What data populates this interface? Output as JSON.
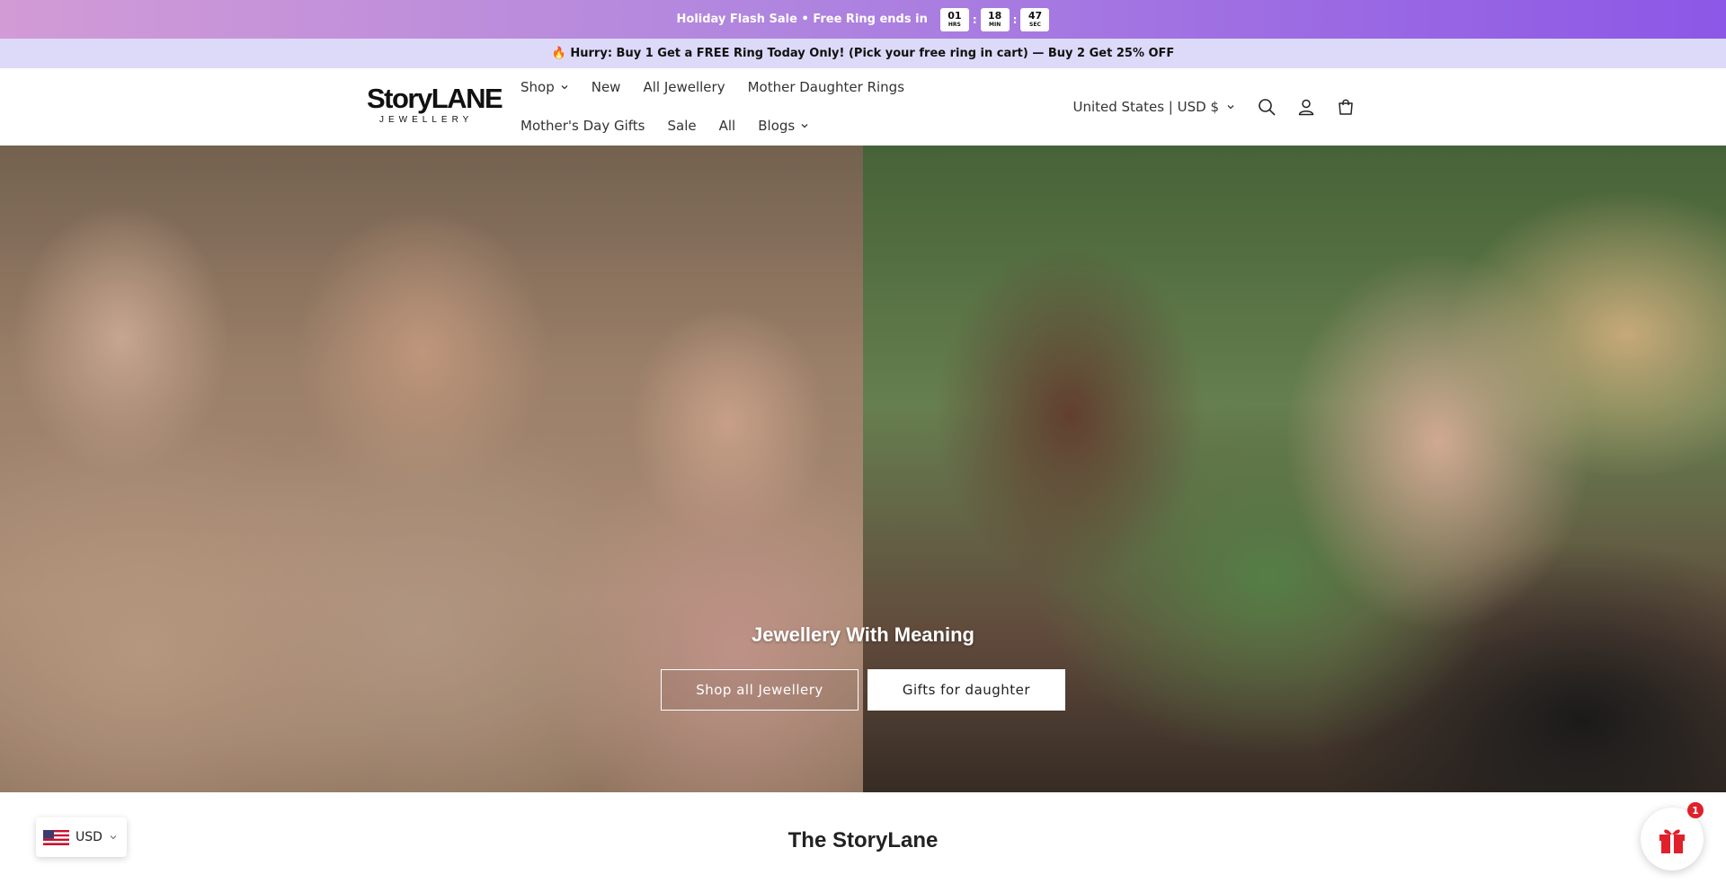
{
  "flash_bar": {
    "text": "Holiday Flash Sale • Free Ring ends in",
    "countdown": [
      {
        "value": "01",
        "unit": "HRS"
      },
      {
        "value": "18",
        "unit": "MIN"
      },
      {
        "value": "47",
        "unit": "SEC"
      }
    ],
    "separator": ":"
  },
  "promo_bar": {
    "text": "🔥 Hurry: Buy 1 Get a FREE Ring Today Only! (Pick your free ring in cart) — Buy 2 Get 25% OFF"
  },
  "header": {
    "logo_main": "StoryLANE",
    "logo_sub": "JEWELLERY",
    "nav_row1": [
      "Shop",
      "New",
      "All Jewellery",
      "Mother Daughter Rings"
    ],
    "nav_row2": [
      "Mother's Day Gifts",
      "Sale",
      "All",
      "Blogs"
    ],
    "locale": "United States | USD $",
    "icons": [
      "search-icon",
      "account-icon",
      "cart-icon"
    ]
  },
  "hero": {
    "title": "Jewellery With Meaning",
    "button_primary": "Shop all Jewellery",
    "button_secondary": "Gifts for daughter"
  },
  "section": {
    "title": "The StoryLane"
  },
  "currency_widget": {
    "label": "USD"
  },
  "gift_widget": {
    "badge": "1"
  },
  "colors": {
    "flash_gradient_start": "#d29bd6",
    "flash_gradient_end": "#8c57e6",
    "promo_bg": "#dcdaf8",
    "badge_red": "#e0202a"
  }
}
